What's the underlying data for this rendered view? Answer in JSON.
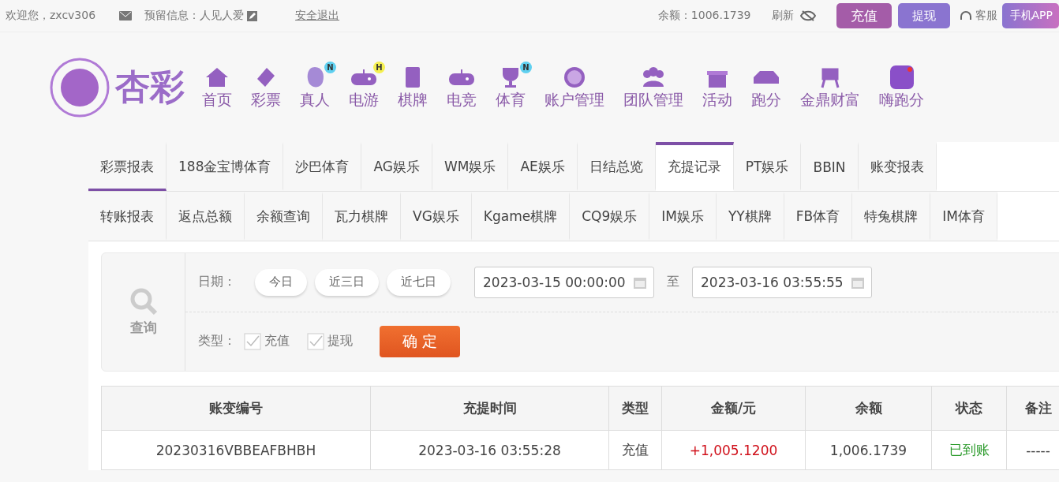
{
  "topbar": {
    "welcome": "欢迎您，zxcv306",
    "message": "预留信息：人见人爱",
    "logout": "安全退出",
    "balance": "余额：1006.1739",
    "refresh": "刷新",
    "buttons": [
      {
        "label": "充值",
        "kind": "deposit"
      },
      {
        "label": "提现",
        "kind": "withdraw"
      }
    ],
    "service": "客服",
    "app": "手机APP"
  },
  "logo": {
    "text": "杏彩"
  },
  "nav": [
    {
      "label": "首页"
    },
    {
      "label": "彩票"
    },
    {
      "label": "真人",
      "badge": "N"
    },
    {
      "label": "电游",
      "badge": "H"
    },
    {
      "label": "棋牌"
    },
    {
      "label": "电竞"
    },
    {
      "label": "体育",
      "badge": "N"
    },
    {
      "label": "账户管理"
    },
    {
      "label": "团队管理"
    },
    {
      "label": "活动"
    },
    {
      "label": "跑分"
    },
    {
      "label": "金鼎财富"
    },
    {
      "label": "嗨跑分"
    }
  ],
  "tabs": [
    [
      {
        "label": "彩票报表",
        "selected": false,
        "underlined": true
      },
      {
        "label": "188金宝博体育",
        "selected": false,
        "underlined": false
      },
      {
        "label": "沙巴体育",
        "selected": false,
        "underlined": false
      },
      {
        "label": "AG娱乐",
        "selected": false,
        "underlined": false
      },
      {
        "label": "WM娱乐",
        "selected": false,
        "underlined": false
      },
      {
        "label": "AE娱乐",
        "selected": false,
        "underlined": false
      },
      {
        "label": "日结总览",
        "selected": false,
        "underlined": false
      },
      {
        "label": "充提记录",
        "selected": true,
        "underlined": false
      },
      {
        "label": "PT娱乐",
        "selected": false,
        "underlined": false
      },
      {
        "label": "BBIN",
        "selected": false,
        "underlined": false
      },
      {
        "label": "账变报表",
        "selected": false,
        "underlined": false
      }
    ],
    [
      {
        "label": "转账报表",
        "selected": false,
        "underlined": false
      },
      {
        "label": "返点总额",
        "selected": false,
        "underlined": false
      },
      {
        "label": "余额查询",
        "selected": false,
        "underlined": false
      },
      {
        "label": "瓦力棋牌",
        "selected": false,
        "underlined": false
      },
      {
        "label": "VG娱乐",
        "selected": false,
        "underlined": false
      },
      {
        "label": "Kgame棋牌",
        "selected": false,
        "underlined": false
      },
      {
        "label": "CQ9娱乐",
        "selected": false,
        "underlined": false
      },
      {
        "label": "IM娱乐",
        "selected": false,
        "underlined": false
      },
      {
        "label": "YY棋牌",
        "selected": false,
        "underlined": false
      },
      {
        "label": "FB体育",
        "selected": false,
        "underlined": false
      },
      {
        "label": "特兔棋牌",
        "selected": false,
        "underlined": false
      },
      {
        "label": "IM体育",
        "selected": false,
        "underlined": false
      }
    ]
  ],
  "query": {
    "label": "查询",
    "date_label": "日期：",
    "presets": [
      "今日",
      "近三日",
      "近七日"
    ],
    "from": "2023-03-15 00:00:00",
    "to_label": "至",
    "to": "2023-03-16 03:55:55",
    "type_label": "类型：",
    "types": [
      {
        "label": "充值",
        "checked": true
      },
      {
        "label": "提现",
        "checked": true
      }
    ],
    "confirm": "确 定"
  },
  "table": {
    "columns": [
      "账变编号",
      "充提时间",
      "类型",
      "金额/元",
      "余额",
      "状态",
      "备注"
    ],
    "rows": [
      {
        "cells": [
          "20230316VBBEAFBHBH",
          "2023-03-16 03:55:28",
          "充值",
          "+1,005.1200",
          "1,006.1739",
          "已到账",
          "-----"
        ]
      }
    ]
  }
}
